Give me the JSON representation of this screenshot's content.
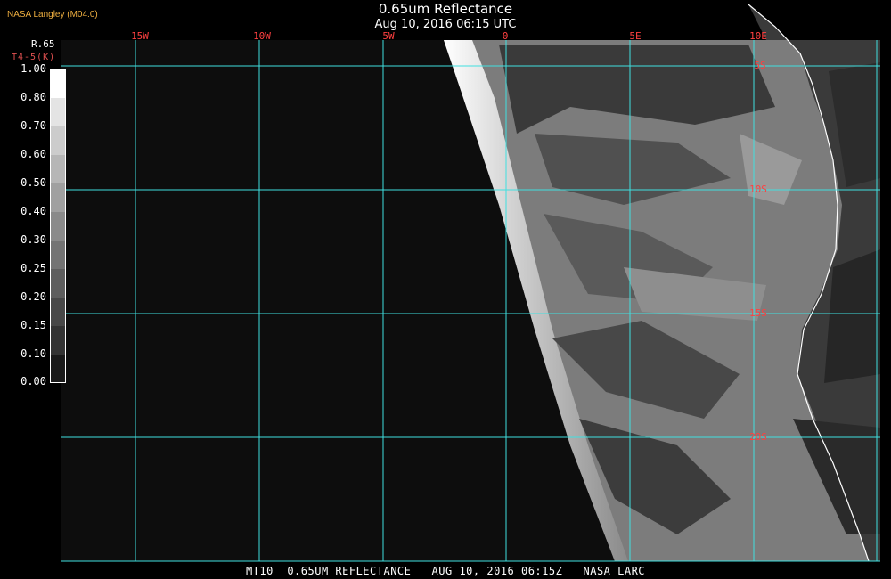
{
  "header": {
    "title": "0.65um Reflectance",
    "subtitle": "Aug 10, 2016 06:15 UTC",
    "organization": "NASA Langley (M04.0)"
  },
  "colorbar": {
    "band_label": "R.65",
    "sub_label": "T4-5(K)",
    "ticks": [
      "1.00",
      "0.80",
      "0.70",
      "0.60",
      "0.50",
      "0.40",
      "0.30",
      "0.25",
      "0.20",
      "0.15",
      "0.10",
      "0.00"
    ]
  },
  "grid": {
    "lon_labels": [
      "15W",
      "10W",
      "5W",
      "0",
      "5E",
      "10E"
    ],
    "lat_labels": [
      "5S",
      "10S",
      "15S",
      "20S"
    ],
    "line_color": "#40e0e0"
  },
  "footer": {
    "text": "MT10  0.65UM REFLECTANCE   AUG 10, 2016 06:15Z   NASA LARC"
  },
  "colors": {
    "background": "#000000",
    "label_red": "#ff4040",
    "org_orange": "#f0b040",
    "coastline": "#ffffff"
  }
}
